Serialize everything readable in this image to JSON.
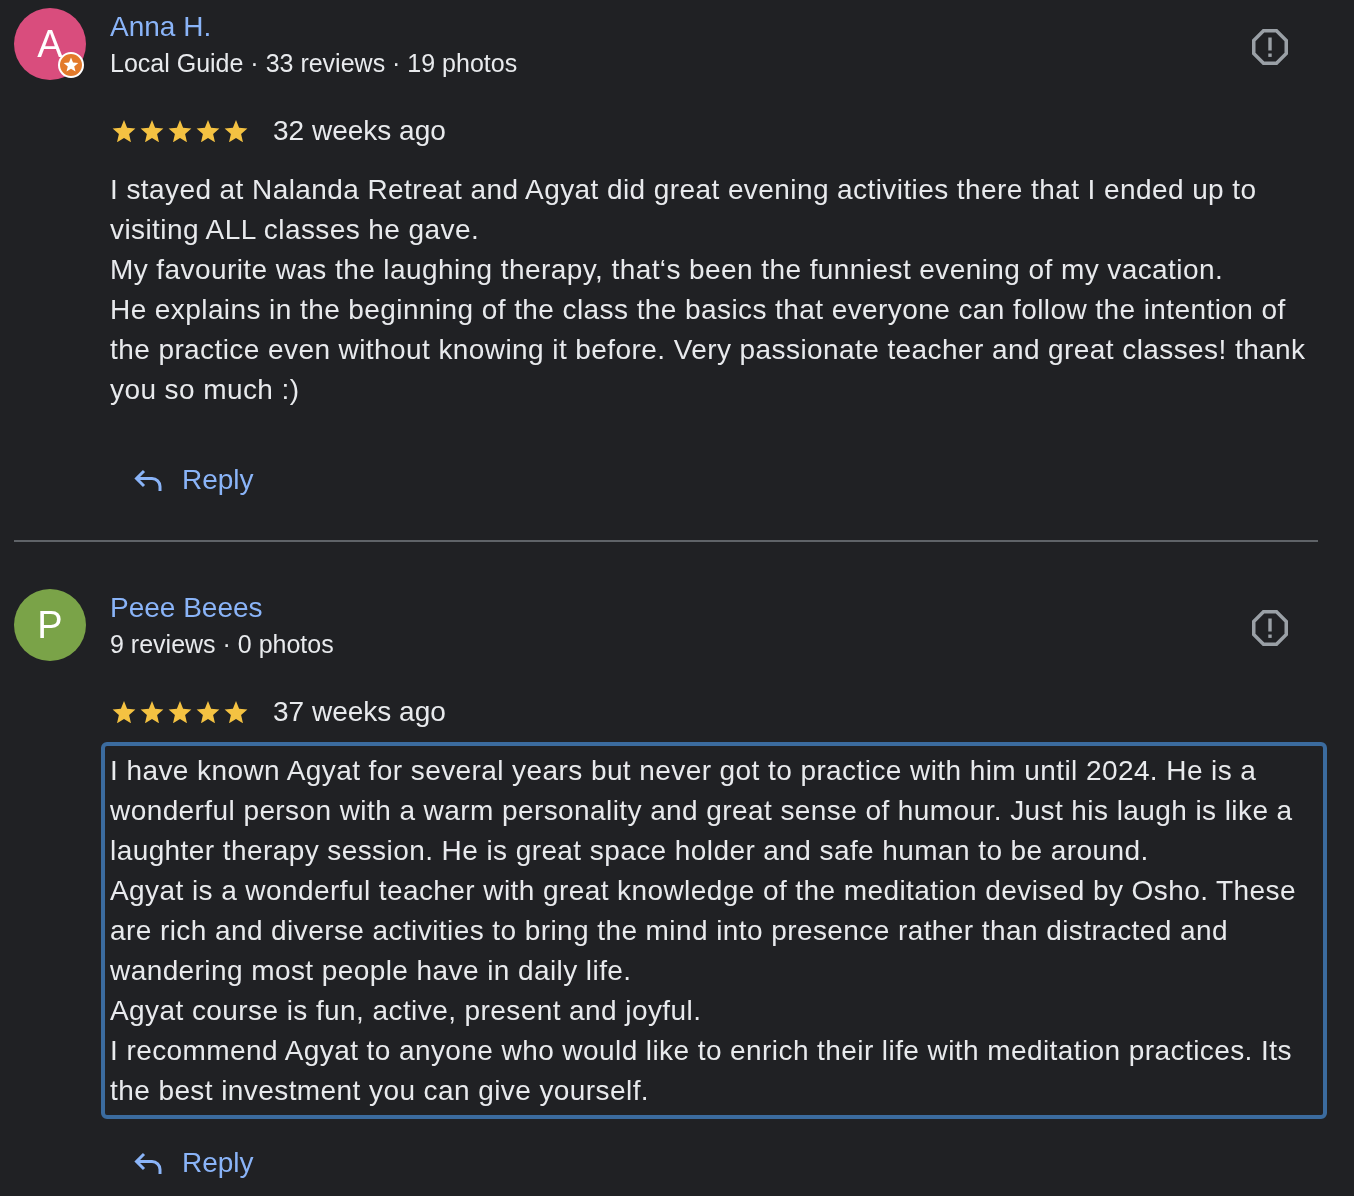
{
  "reviews": [
    {
      "avatar": {
        "letter": "A",
        "color": "#d94d7d",
        "local_guide_badge": true
      },
      "name": "Anna H.",
      "stats": "Local Guide · 33 reviews · 19 photos",
      "stars": 5,
      "date": "32 weeks ago",
      "body": {
        "text": "I stayed at Nalanda Retreat and Agyat did great evening activities there that I ended up to visiting ALL classes he gave.\nMy favourite was the laughing therapy, that‘s been the funniest evening of my vacation.\nHe explains in the beginning of the class the basics that everyone can follow the intention of the practice even without knowing it before. Very passionate teacher and great classes! thank you so much :)",
        "focused": false
      },
      "reply": "Reply"
    },
    {
      "avatar": {
        "letter": "P",
        "color": "#7aa348",
        "local_guide_badge": false
      },
      "name": "Peee Beees",
      "stats": "9 reviews · 0 photos",
      "stars": 5,
      "date": "37 weeks ago",
      "body": {
        "text": "I have known Agyat for several years but never got to practice with him until 2024. He is a wonderful person with a warm personality and great sense of humour. Just his laugh is like a laughter therapy session. He is great space holder and safe human to be around.\nAgyat is a wonderful teacher with great knowledge of the meditation devised by Osho. These are rich and diverse activities to bring the mind into presence rather than distracted and wandering most people have in daily life.\nAgyat course is fun, active, present and joyful.\nI recommend Agyat to anyone who would like to enrich their life with meditation practices. Its the best investment you can give yourself.",
        "focused": true
      },
      "reply": "Reply"
    }
  ]
}
